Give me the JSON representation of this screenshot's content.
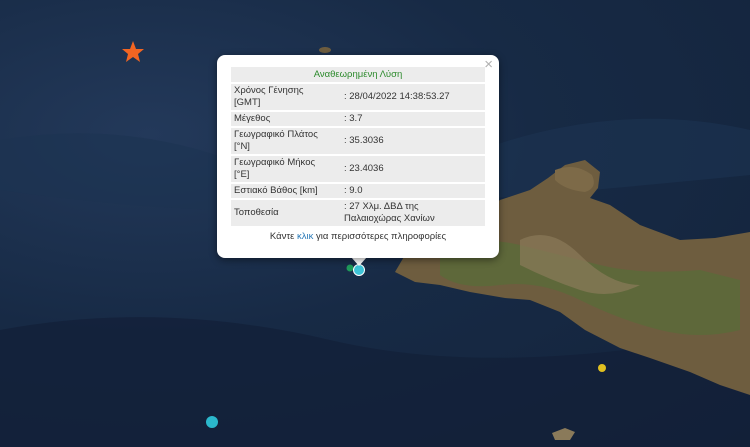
{
  "popup": {
    "title": "Αναθεωρημένη Λύση",
    "close_label": "×",
    "rows": [
      {
        "key_line1": "Χρόνος Γένησης",
        "key_line2": "[GMT]",
        "value": ": 28/04/2022 14:38:53.27"
      },
      {
        "key_line1": "Μέγεθος",
        "key_line2": "",
        "value": ": 3.7"
      },
      {
        "key_line1": "Γεωγραφικό Πλάτος",
        "key_line2": "[°N]",
        "value": ": 35.3036"
      },
      {
        "key_line1": "Γεωγραφικό Μήκος",
        "key_line2": "[°E]",
        "value": ": 23.4036"
      },
      {
        "key_line1": "Εστιακό Βάθος [km]",
        "key_line2": "",
        "value": ": 9.0"
      },
      {
        "key_line1": "Τοποθεσία",
        "key_line2": "",
        "value_line1": ": 27 Χλμ. ΔΒΔ της",
        "value_line2": "Παλαιοχώρας Χανίων"
      }
    ],
    "footer_pre": "Κάντε",
    "footer_link": "κλικ",
    "footer_post": "για περισσότερες πληροφορίες"
  },
  "markers": {
    "star_color": "#f26522",
    "selected_color": "#3ec3d6",
    "green_color": "#1f9a5a",
    "yellow_color": "#e0c020",
    "cyan_color": "#2bb8cc"
  }
}
